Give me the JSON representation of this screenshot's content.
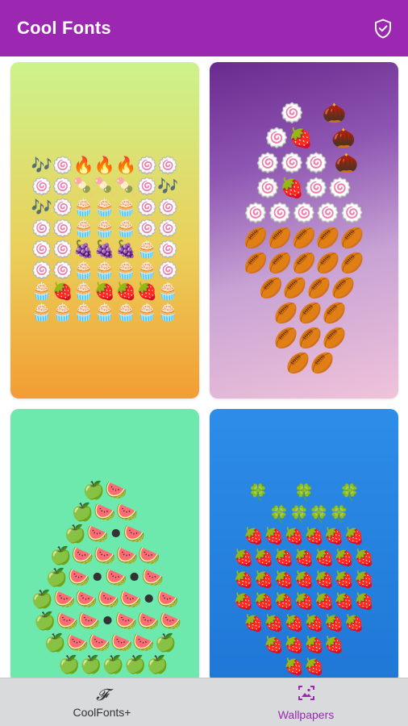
{
  "appbar": {
    "title": "Cool Fonts",
    "action_icon": "shield-check-icon",
    "background": "#9c27b0"
  },
  "wallpapers": [
    {
      "background": "yellow-orange gradient",
      "art": "🎶🍥🔥🔥🔥🍥🍥\n🍥🍥🍡🍡🍡🍥🎶\n🎶🍥🧁🧁🧁🍥🍥\n🍥🍥🧁🧁🧁🍥🍥\n🍥🍥🍇🍇🍇🧁🍥\n🍥🍥🧁🧁🧁🧁🍥\n🧁🍓🧁🍓🍓🍓🧁\n🧁🧁🧁🧁🧁🧁🧁"
    },
    {
      "background": "purple-pink gradient",
      "art": "   🍥   🌰\n  🍥🍓   🌰\n 🍥🍥🍥 🌰\n🍥🍓🍥🍥\n🍥🍥🍥🍥🍥\n🏉🏉🏉🏉🏉\n🏉🏉🏉🏉🏉\n 🏉🏉🏉🏉\n  🏉🏉🏉\n  🏉🏉🏉\n  🏉🏉"
    },
    {
      "background": "mint green",
      "art": "🍏🍉\n🍏🍉🍉\n🍏🍉⚫🍉\n🍏🍉🍉🍉🍉\n🍏🍉⚫🍉⚫🍉\n🍏🍉🍉🍉🍉⚫🍉\n 🍏🍉🍉⚫🍉🍉🍉\n  🍏🍉🍉🍉🍉🍏\n   🍏🍏🍏🍏🍏"
    },
    {
      "background": "blue",
      "art": "🍀     🍀     🍀\n  🍀🍀🍀🍀\n🍓🍓🍓🍓🍓🍓\n🍓🍓🍓🍓🍓🍓🍓\n🍓🍓🍓🍓🍓🍓🍓\n🍓🍓🍓🍓🍓🍓🍓\n🍓🍓🍓🍓🍓🍓\n🍓🍓🍓🍓\n🍓🍓"
    }
  ],
  "bottom_nav": {
    "items": [
      {
        "label": "CoolFonts+",
        "icon": "f-script-icon",
        "active": false
      },
      {
        "label": "Wallpapers",
        "icon": "wallpaper-icon",
        "active": true
      }
    ],
    "active_color": "#9c27b0",
    "background": "#d8dadc"
  }
}
